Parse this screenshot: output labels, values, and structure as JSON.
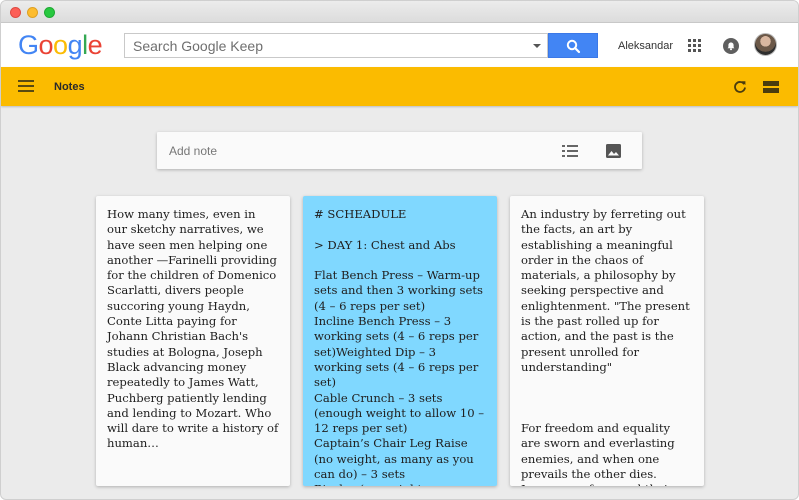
{
  "header": {
    "logo_letters": [
      "G",
      "o",
      "o",
      "g",
      "l",
      "e"
    ],
    "search_placeholder": "Search Google Keep",
    "username": "Aleksandar",
    "colors": {
      "search_button": "#4285f4",
      "appbar": "#fbbb00"
    }
  },
  "appbar": {
    "title": "Notes"
  },
  "composer": {
    "placeholder": "Add note"
  },
  "notes": [
    {
      "color": "#fafafa",
      "text": "How many times, even in our sketchy narratives, we have seen men helping one another —Farinelli providing for the children of Domenico Scarlatti, divers people succoring young Haydn, Conte Litta paying for Johann Christian Bach's studies at Bologna, Joseph Black advancing money repeatedly to James Watt, Puchberg patiently lending and lending to Mozart. Who will dare to write a history of human…"
    },
    {
      "color": "#80d8ff",
      "text": "# SCHEADULE\n\n> DAY 1: Chest and Abs\n\nFlat Bench Press – Warm-up sets and then 3 working sets (4 – 6 reps per set)\nIncline Bench Press – 3 working sets (4 – 6 reps per set)Weighted Dip – 3 working sets (4 – 6 reps per set)\nCable Crunch – 3 sets (enough weight to allow 10 – 12 reps per set)\nCaptain’s Chair Leg Raise (no weight, as many as you can do) – 3 sets\nBicyles (no weight, as many as you can…"
    },
    {
      "color": "#fafafa",
      "text": "An industry by ferreting out the facts, an art by establishing a meaningful order in the chaos of materials, a philosophy by seeking perspective and enlightenment. \"The present is the past rolled up for action, and the past is the present unrolled for understanding\"\n\n\n\nFor freedom and equality are sworn and everlasting enemies, and when one prevails the other dies. Leave men free, and their…"
    }
  ]
}
